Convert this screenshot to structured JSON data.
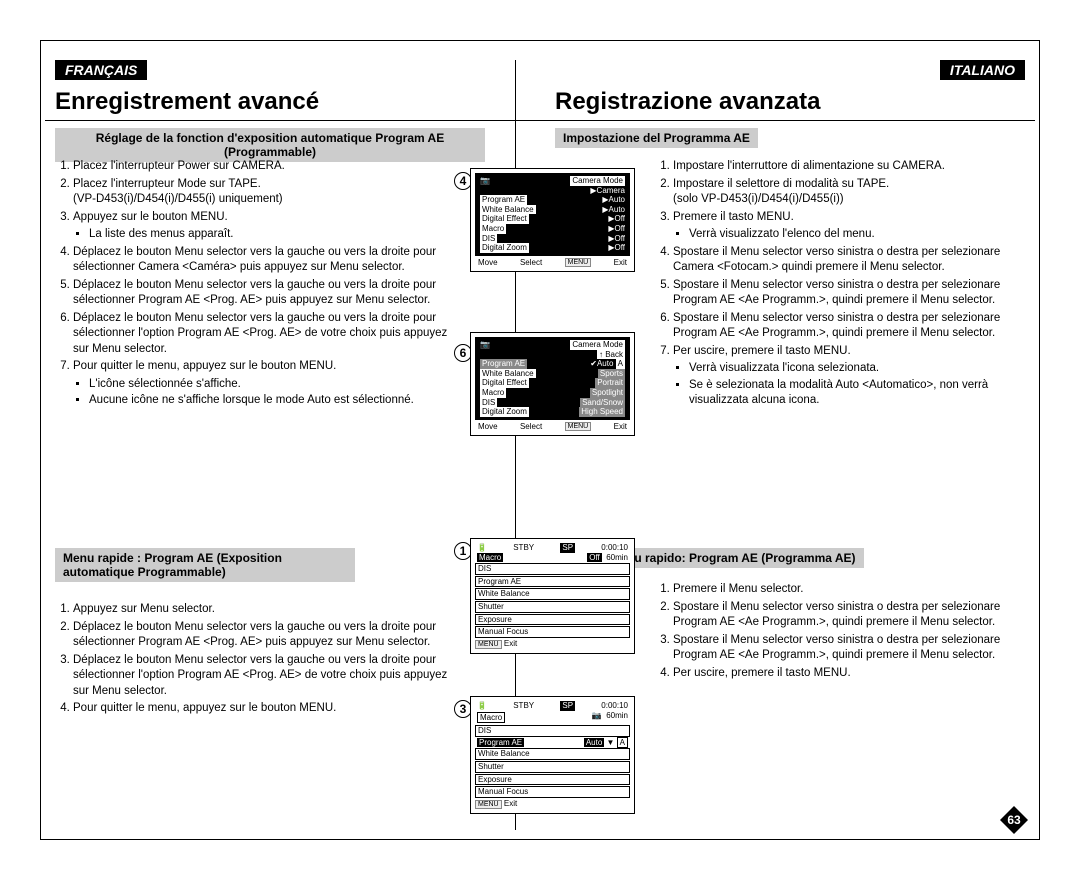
{
  "page_number": "63",
  "fr": {
    "lang_label": "FRANÇAIS",
    "title": "Enregistrement avancé",
    "subhead1": "Réglage de la fonction d'exposition automatique Program AE (Programmable)",
    "subhead2": "Menu rapide : Program AE (Exposition automatique Programmable)",
    "steps1": {
      "s1": "Placez l'interrupteur Power sur CAMERA.",
      "s2": "Placez l'interrupteur Mode sur TAPE.",
      "s2b": "(VP-D453(i)/D454(i)/D455(i) uniquement)",
      "s3": "Appuyez sur le bouton MENU.",
      "s3a": "La liste des menus apparaît.",
      "s4": "Déplacez le bouton Menu selector vers la gauche ou vers la droite pour sélectionner Camera <Caméra> puis appuyez sur Menu selector.",
      "s5": "Déplacez le bouton Menu selector vers la gauche ou vers la droite pour sélectionner Program AE <Prog. AE> puis appuyez sur Menu selector.",
      "s6": "Déplacez le bouton Menu selector vers la gauche ou vers la droite pour sélectionner l'option Program AE <Prog. AE> de votre choix puis appuyez sur Menu selector.",
      "s7": "Pour quitter le menu, appuyez sur le bouton MENU.",
      "s7a": "L'icône sélectionnée s'affiche.",
      "s7b": "Aucune icône ne s'affiche lorsque le mode Auto est sélectionné."
    },
    "steps2": {
      "s1": "Appuyez sur Menu selector.",
      "s2": "Déplacez le bouton Menu selector vers la gauche ou vers la droite pour sélectionner Program AE <Prog. AE> puis appuyez sur Menu selector.",
      "s3": "Déplacez le bouton Menu selector vers la gauche ou vers la droite pour sélectionner l'option Program AE <Prog. AE> de votre choix puis appuyez sur Menu selector.",
      "s4": "Pour quitter le menu, appuyez sur le bouton MENU."
    }
  },
  "it": {
    "lang_label": "ITALIANO",
    "title": "Registrazione avanzata",
    "subhead1": "Impostazione del Programma AE",
    "subhead2": "Uso del menu rapido: Program AE (Programma AE)",
    "steps1": {
      "s1": "Impostare l'interruttore di alimentazione su CAMERA.",
      "s2": "Impostare il selettore di modalità su TAPE.",
      "s2b": "(solo VP-D453(i)/D454(i)/D455(i))",
      "s3": "Premere il tasto MENU.",
      "s3a": "Verrà visualizzato l'elenco del menu.",
      "s4": "Spostare il Menu selector verso sinistra o destra per selezionare Camera <Fotocam.> quindi premere il Menu selector.",
      "s5": "Spostare il Menu selector verso sinistra o destra per selezionare Program AE <Ae Programm.>, quindi premere il Menu selector.",
      "s6": "Spostare il Menu selector verso sinistra o destra per selezionare Program AE <Ae Programm.>, quindi premere il Menu selector.",
      "s7": "Per uscire, premere il tasto MENU.",
      "s7a": "Verrà visualizzata l'icona selezionata.",
      "s7b": "Se è selezionata la modalità Auto <Automatico>, non verrà visualizzata alcuna icona."
    },
    "steps2": {
      "s1": "Premere il Menu selector.",
      "s2": "Spostare il Menu selector verso sinistra o destra per selezionare Program AE <Ae Programm.>, quindi premere il Menu selector.",
      "s3": "Spostare il Menu selector verso sinistra o destra per selezionare Program AE <Ae Programm.>, quindi premere il Menu selector.",
      "s4": "Per uscire, premere il tasto MENU."
    }
  },
  "diagrams": {
    "d4": {
      "title": "Camera Mode",
      "sel": "▶Camera",
      "rows": [
        [
          "Program AE",
          "▶Auto"
        ],
        [
          "White Balance",
          "▶Auto"
        ],
        [
          "Digital Effect",
          "▶Off"
        ],
        [
          "Macro",
          "▶Off"
        ],
        [
          "DIS",
          "▶Off"
        ],
        [
          "Digital Zoom",
          "▶Off"
        ]
      ],
      "footer": [
        "Move",
        "Select",
        "MENU",
        "Exit"
      ]
    },
    "d6": {
      "title": "Camera Mode",
      "back": "Back",
      "rows": [
        [
          "Program AE",
          "✔Auto",
          "A"
        ],
        [
          "White Balance",
          "Sports",
          ""
        ],
        [
          "Digital Effect",
          "Portrait",
          ""
        ],
        [
          "Macro",
          "Spotlight",
          ""
        ],
        [
          "DIS",
          "Sand/Snow",
          ""
        ],
        [
          "Digital Zoom",
          "High Speed",
          ""
        ]
      ],
      "footer": [
        "Move",
        "Select",
        "MENU",
        "Exit"
      ]
    },
    "d1": {
      "status": [
        "STBY",
        "SP",
        "0:00:10",
        "60min"
      ],
      "rows": [
        "Macro",
        "DIS",
        "Program AE",
        "White Balance",
        "Shutter",
        "Exposure",
        "Manual Focus"
      ],
      "hl_row": "Macro",
      "hl_val": "Off",
      "exit": "MENU Exit"
    },
    "d3": {
      "status": [
        "STBY",
        "SP",
        "0:00:10",
        "60min"
      ],
      "rows": [
        "Macro",
        "DIS",
        "Program AE",
        "White Balance",
        "Shutter",
        "Exposure",
        "Manual Focus"
      ],
      "hl_row": "Program AE",
      "hl_val": "Auto",
      "hl_badge": "A",
      "exit": "MENU Exit"
    }
  }
}
